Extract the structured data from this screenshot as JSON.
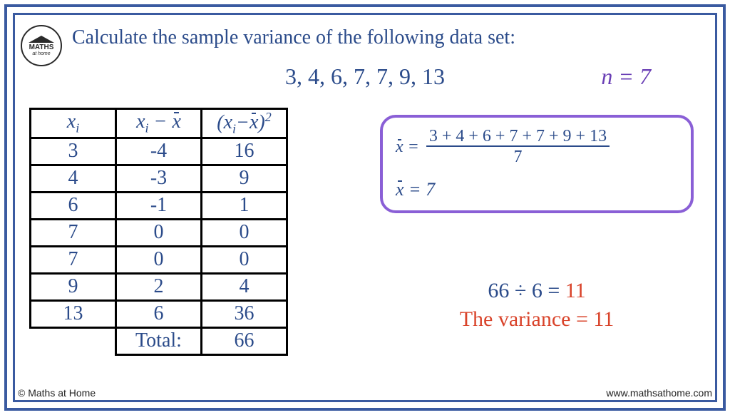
{
  "title": "Calculate the sample variance of the following data set:",
  "data_list": "3, 4, 6, 7, 7, 9, 13",
  "n_label": "n = 7",
  "table": {
    "headers": {
      "h1": "xᵢ",
      "h2": "xᵢ − x̄",
      "h3": "(xᵢ−x̄)²"
    },
    "rows": [
      {
        "xi": "3",
        "diff": "-4",
        "sq": "16"
      },
      {
        "xi": "4",
        "diff": "-3",
        "sq": "9"
      },
      {
        "xi": "6",
        "diff": "-1",
        "sq": "1"
      },
      {
        "xi": "7",
        "diff": "0",
        "sq": "0"
      },
      {
        "xi": "7",
        "diff": "0",
        "sq": "0"
      },
      {
        "xi": "9",
        "diff": "2",
        "sq": "4"
      },
      {
        "xi": "13",
        "diff": "6",
        "sq": "36"
      }
    ],
    "total_label": "Total:",
    "total_value": "66"
  },
  "mean": {
    "lhs": "x̄ =",
    "numerator": "3 + 4 + 6 + 7 + 7 + 9 + 13",
    "denominator": "7",
    "result": "x̄ = 7"
  },
  "answer": {
    "calc_left": "66 ÷ 6 =",
    "calc_right": "11",
    "text_left": "The variance =",
    "text_right": " 11"
  },
  "logo": {
    "line1": "MATHS",
    "line2": "at home"
  },
  "footer": {
    "copyright": "© Maths at Home",
    "website": "www.mathsathome.com"
  }
}
